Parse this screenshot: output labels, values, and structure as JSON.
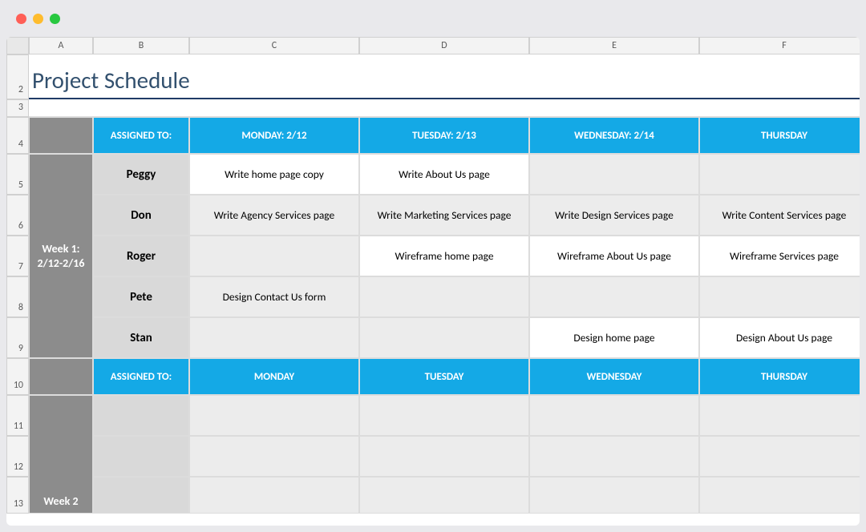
{
  "columns": [
    "A",
    "B",
    "C",
    "D",
    "E",
    "F"
  ],
  "rows": [
    "2",
    "3",
    "4",
    "5",
    "6",
    "7",
    "8",
    "9",
    "10",
    "11",
    "12",
    "13"
  ],
  "title": "Project Schedule",
  "headerRow1": {
    "assigned": "ASSIGNED TO:",
    "mon": "MONDAY: 2/12",
    "tue": "TUESDAY: 2/13",
    "wed": "WEDNESDAY: 2/14",
    "thu": "THURSDAY"
  },
  "week1": {
    "label": "Week 1:\n2/12-2/16",
    "people": [
      {
        "name": "Peggy",
        "tasks": [
          "Write home page copy",
          "Write About Us page",
          "",
          ""
        ],
        "shade": false
      },
      {
        "name": "Don",
        "tasks": [
          "Write Agency Services page",
          "Write Marketing Services page",
          "Write Design Services page",
          "Write Content Services page"
        ],
        "shade": true
      },
      {
        "name": "Roger",
        "tasks": [
          "",
          "Wireframe home page",
          "Wireframe About Us page",
          "Wireframe Services page"
        ],
        "shade": false
      },
      {
        "name": "Pete",
        "tasks": [
          "Design Contact Us form",
          "",
          "",
          ""
        ],
        "shade": true
      },
      {
        "name": "Stan",
        "tasks": [
          "",
          "",
          "Design home page",
          "Design About Us page"
        ],
        "shade": false
      }
    ]
  },
  "headerRow2": {
    "assigned": "ASSIGNED TO:",
    "mon": "MONDAY",
    "tue": "TUESDAY",
    "wed": "WEDNESDAY",
    "thu": "THURSDAY"
  },
  "week2": {
    "label": "Week 2",
    "people": [
      {
        "name": "",
        "tasks": [
          "",
          "",
          "",
          ""
        ],
        "shade": true
      },
      {
        "name": "",
        "tasks": [
          "",
          "",
          "",
          ""
        ],
        "shade": true
      },
      {
        "name": "",
        "tasks": [
          "",
          "",
          "",
          ""
        ],
        "shade": true
      }
    ]
  }
}
